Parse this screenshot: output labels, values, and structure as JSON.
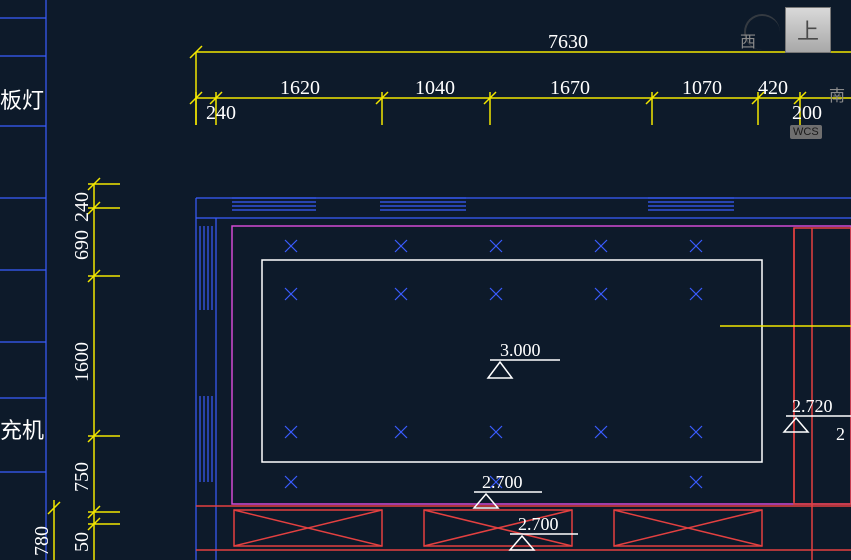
{
  "viewcube": {
    "face": "上",
    "west": "西",
    "south": "南",
    "wcs": "WCS"
  },
  "legend": {
    "item1": "板灯",
    "item2": "充机"
  },
  "top_chain": {
    "overall": "7630",
    "segments": [
      "240",
      "1620",
      "1040",
      "1670",
      "1070",
      "420",
      "200"
    ]
  },
  "left_chain": {
    "segments": [
      "240",
      "690",
      "1600",
      "750",
      "50"
    ],
    "bottom_extra": "780"
  },
  "levels": {
    "center": "3.000",
    "bottom_a": "2.700",
    "bottom_b": "2.700",
    "right": "2.720"
  }
}
